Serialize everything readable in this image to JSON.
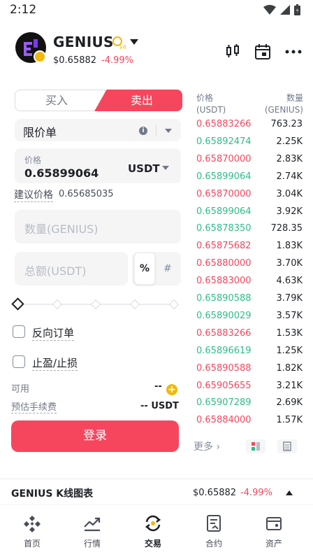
{
  "status_bar": {
    "time": "2:12"
  },
  "header": {
    "pair": "GENIUS",
    "leverage_badge": "x4",
    "last_price": "$0.65882",
    "change": "-4.99%"
  },
  "trade_tabs": {
    "buy": "买入",
    "sell": "卖出"
  },
  "order_type": {
    "label": "限价单",
    "info": "i"
  },
  "price_field": {
    "label": "价格",
    "value": "0.65899064",
    "unit": "USDT"
  },
  "suggested": {
    "label": "建议价格",
    "value": "0.65685035"
  },
  "amount_field": {
    "placeholder": "数量(GENIUS)"
  },
  "total_field": {
    "placeholder": "总额(USDT)",
    "pct_label": "%",
    "hash_label": "#"
  },
  "slider": {
    "value_pct": 0
  },
  "options": {
    "reverse": "反向订单",
    "tpsl": "止盈/止损"
  },
  "available": {
    "label": "可用",
    "value": "--"
  },
  "fee": {
    "label": "预估手续费",
    "value": "-- USDT"
  },
  "login_button": "登录",
  "orderbook": {
    "price_header": "价格",
    "price_unit": "(USDT)",
    "qty_header": "数量",
    "qty_unit": "(GENIUS)",
    "rows": [
      {
        "price": "0.65883266",
        "qty": "763.23",
        "side": "sell"
      },
      {
        "price": "0.65892474",
        "qty": "2.25K",
        "side": "buy"
      },
      {
        "price": "0.65870000",
        "qty": "2.83K",
        "side": "sell"
      },
      {
        "price": "0.65899064",
        "qty": "2.74K",
        "side": "buy"
      },
      {
        "price": "0.65870000",
        "qty": "3.04K",
        "side": "sell"
      },
      {
        "price": "0.65899064",
        "qty": "3.92K",
        "side": "buy"
      },
      {
        "price": "0.65878350",
        "qty": "728.35",
        "side": "buy"
      },
      {
        "price": "0.65875682",
        "qty": "1.83K",
        "side": "sell"
      },
      {
        "price": "0.65880000",
        "qty": "3.70K",
        "side": "sell"
      },
      {
        "price": "0.65883000",
        "qty": "4.63K",
        "side": "sell"
      },
      {
        "price": "0.65890588",
        "qty": "3.79K",
        "side": "buy"
      },
      {
        "price": "0.65890029",
        "qty": "3.57K",
        "side": "buy"
      },
      {
        "price": "0.65883266",
        "qty": "1.53K",
        "side": "sell"
      },
      {
        "price": "0.65896619",
        "qty": "1.25K",
        "side": "buy"
      },
      {
        "price": "0.65890588",
        "qty": "1.82K",
        "side": "sell"
      },
      {
        "price": "0.65905655",
        "qty": "3.21K",
        "side": "sell"
      },
      {
        "price": "0.65907289",
        "qty": "2.69K",
        "side": "buy"
      },
      {
        "price": "0.65884000",
        "qty": "1.57K",
        "side": "sell"
      }
    ],
    "more": "更多 ›"
  },
  "chart_bar": {
    "title": "GENIUS K线图表",
    "price": "$0.65882",
    "change": "-4.99%"
  },
  "nav": [
    {
      "label": "首页",
      "icon": "home-icon"
    },
    {
      "label": "行情",
      "icon": "markets-icon"
    },
    {
      "label": "交易",
      "icon": "trade-icon",
      "active": true
    },
    {
      "label": "合约",
      "icon": "futures-icon"
    },
    {
      "label": "资产",
      "icon": "wallet-icon"
    }
  ],
  "colors": {
    "red": "#f6465d",
    "green": "#2ebd85",
    "yellow": "#f0b90b"
  }
}
